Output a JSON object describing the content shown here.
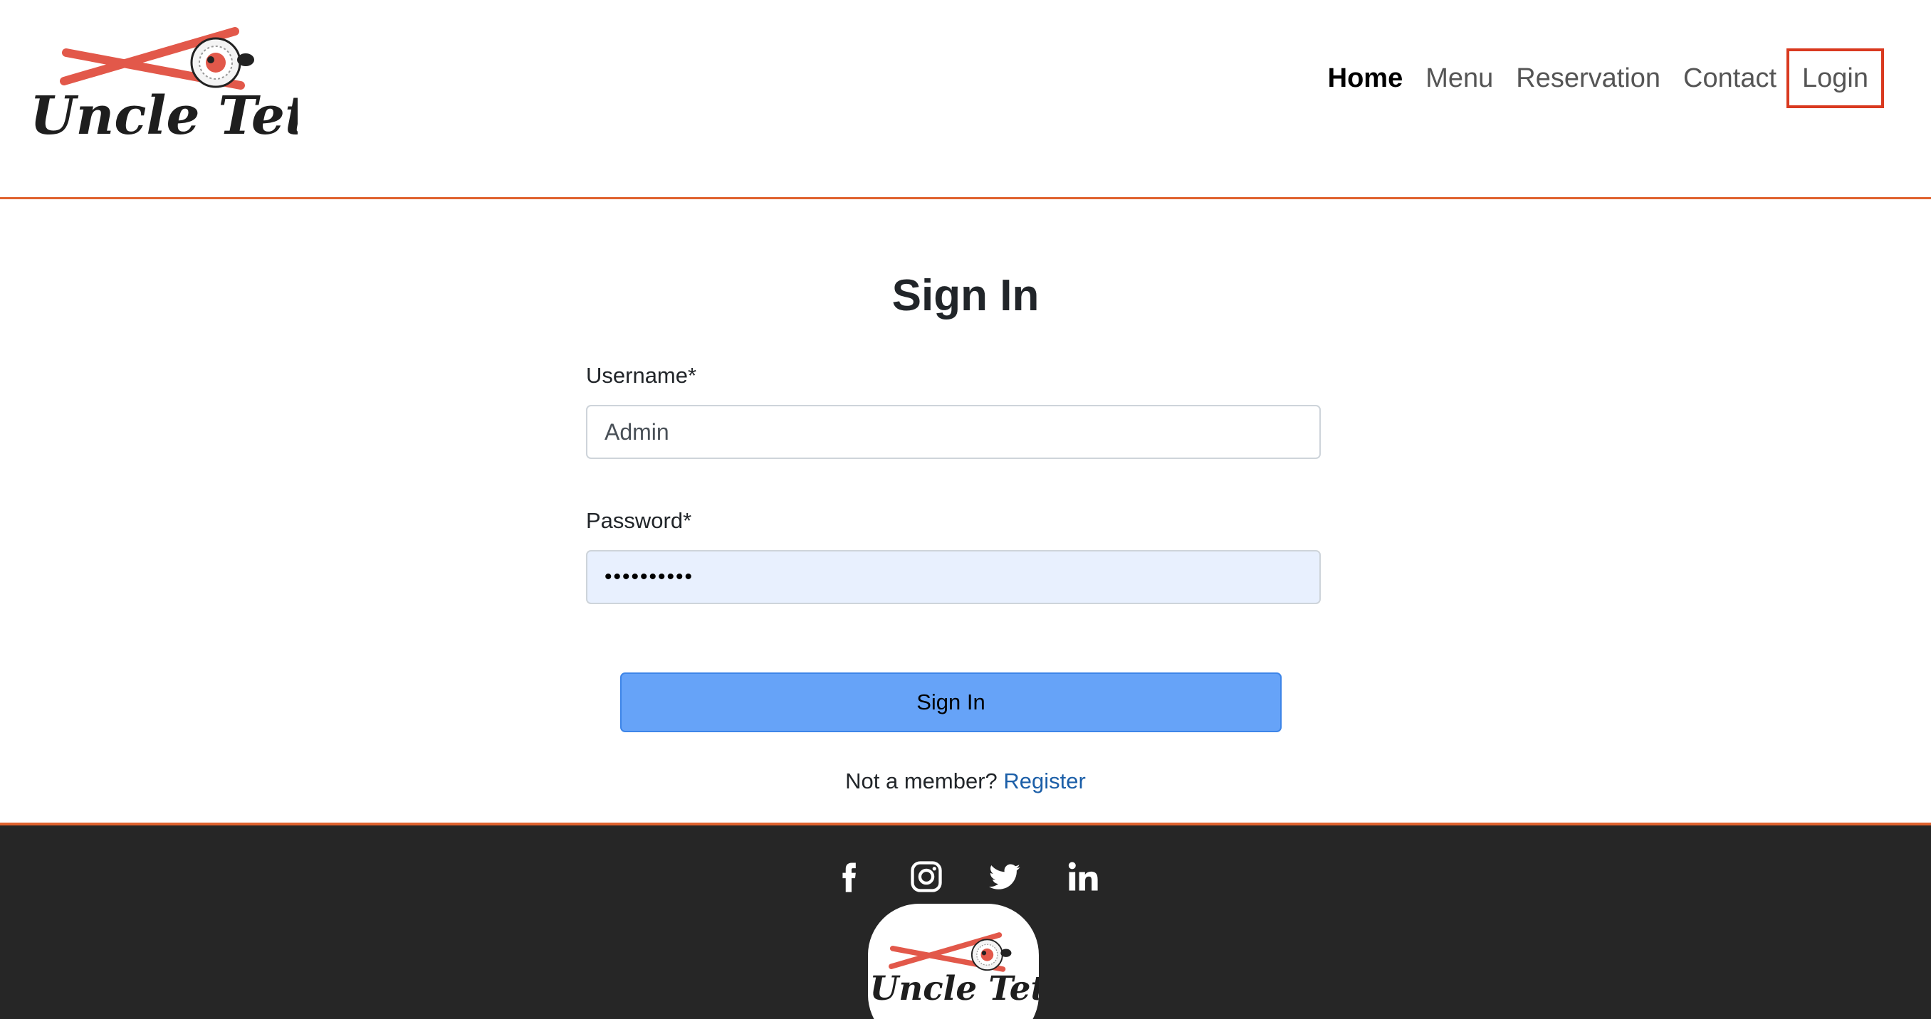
{
  "brand": {
    "name": "Uncle Tetsu",
    "accent_color": "#e0622e",
    "chopstick_color": "#e2584a"
  },
  "nav": {
    "items": [
      {
        "label": "Home",
        "active": true
      },
      {
        "label": "Menu",
        "active": false
      },
      {
        "label": "Reservation",
        "active": false
      },
      {
        "label": "Contact",
        "active": false
      },
      {
        "label": "Login",
        "active": false,
        "highlighted": true
      }
    ]
  },
  "signin": {
    "title": "Sign In",
    "username_label": "Username*",
    "username_value": "Admin",
    "password_label": "Password*",
    "password_value": "••••••••••",
    "button_label": "Sign In",
    "register_prompt": "Not a member?",
    "register_link": "Register"
  },
  "footer": {
    "social_icons": [
      "facebook-icon",
      "instagram-icon",
      "twitter-icon",
      "linkedin-icon"
    ],
    "background_color": "#262626"
  }
}
